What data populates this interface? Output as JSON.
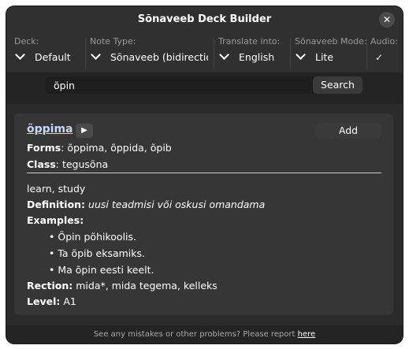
{
  "window": {
    "title": "Sõnaveeb Deck Builder"
  },
  "options": {
    "deck": {
      "label": "Deck:",
      "value": "Default"
    },
    "note_type": {
      "label": "Note Type:",
      "value": "Sõnaveeb (bidirection"
    },
    "translate": {
      "label": "Translate into:",
      "value": "English"
    },
    "mode": {
      "label": "Sõnaveeb Mode:",
      "value": "Lite"
    },
    "audio": {
      "label": "Audio:",
      "checked": true
    }
  },
  "search": {
    "value": "õpin",
    "button_label": "Search"
  },
  "result": {
    "word": "õppima",
    "add_label": "Add",
    "forms_label": "Forms",
    "forms_value": ": õppima, õppida, õpib",
    "class_label": "Class",
    "class_value": ": tegusõna",
    "translation": "learn, study",
    "definition_label": "Definition:",
    "definition_value": "uusi teadmisi või oskusi omandama",
    "examples_label": "Examples:",
    "examples": [
      "Õpin põhikoolis.",
      "Ta õpib eksamiks.",
      "Ma õpin eesti keelt."
    ],
    "rection_label": "Rection:",
    "rection_value": "mida*, mida tegema, kelleks",
    "level_label": "Level:",
    "level_value": "A1"
  },
  "footer": {
    "text": "See any mistakes or other problems? Please report",
    "link": "here"
  }
}
